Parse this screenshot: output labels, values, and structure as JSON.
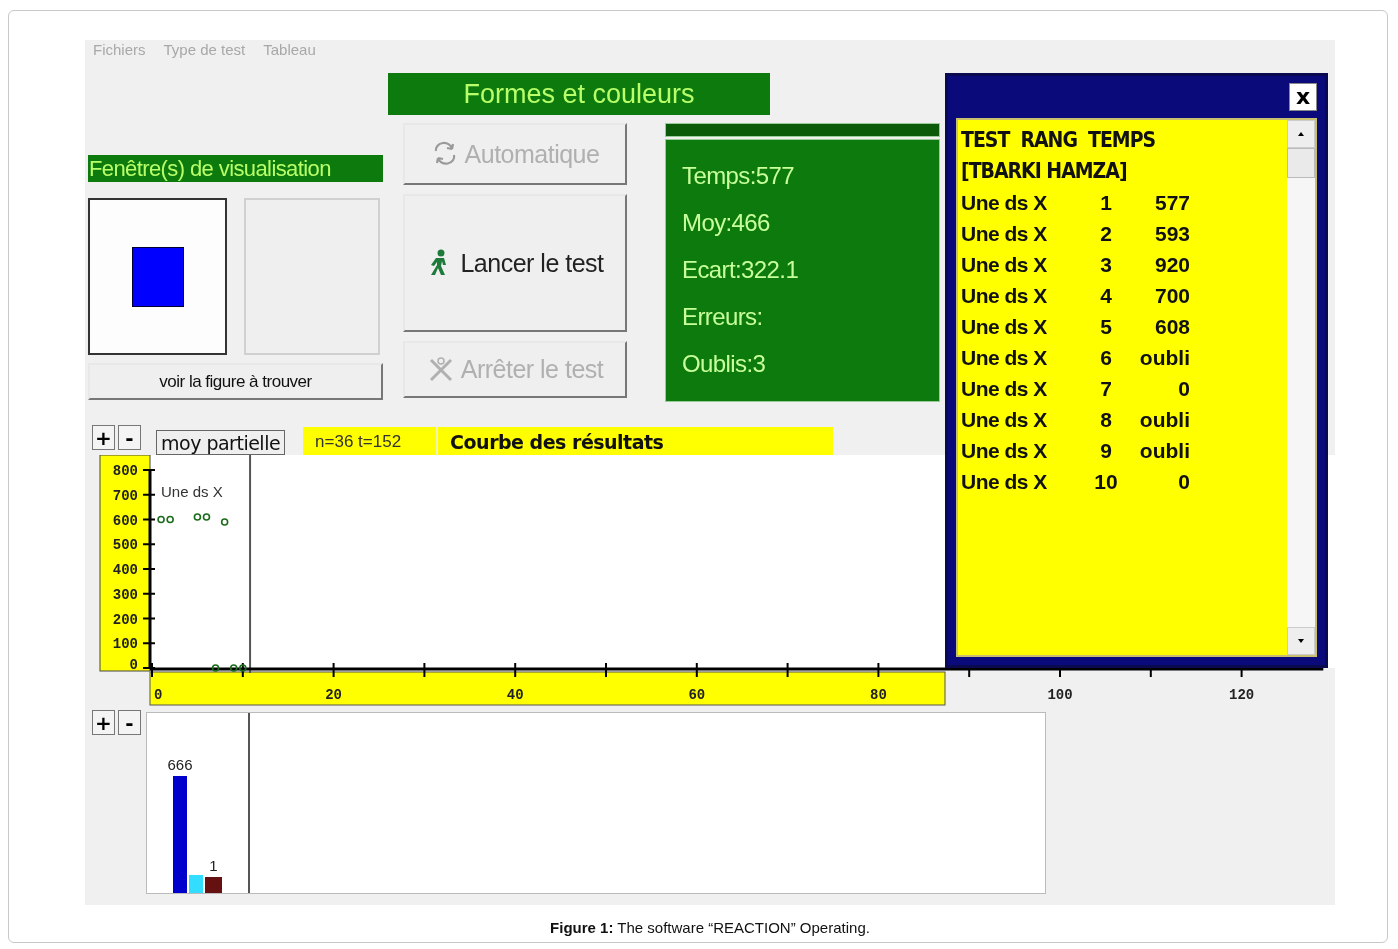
{
  "menu": [
    {
      "label": "Fichiers"
    },
    {
      "label": "Type de test"
    },
    {
      "label": "Tableau"
    }
  ],
  "test_title": "Formes et couleurs",
  "viewer": {
    "label": "Fenêtre(s) de visualisation",
    "previews": [
      {
        "kind": "square",
        "color": "#0000ff"
      },
      {
        "kind": "empty"
      }
    ],
    "button": "voir la figure à trouver"
  },
  "controls": [
    {
      "label": "Automatique",
      "disabled": true
    },
    {
      "label": "Lancer le test",
      "disabled": false
    },
    {
      "label": "Arrêter le test",
      "disabled": true
    }
  ],
  "stats": [
    "Temps:577",
    "Moy:466",
    "Ecart:322.1",
    "Erreurs:",
    "Oublis:3"
  ],
  "result_window": {
    "close": "x",
    "header": "TEST  RANG  TEMPS",
    "subject": "[TBARKI HAMZA]",
    "rows": [
      {
        "test": "Une ds X",
        "rank": "1",
        "time": "577"
      },
      {
        "test": "Une ds X",
        "rank": "2",
        "time": "593"
      },
      {
        "test": "Une ds X",
        "rank": "3",
        "time": "920"
      },
      {
        "test": "Une ds X",
        "rank": "4",
        "time": "700"
      },
      {
        "test": "Une ds X",
        "rank": "5",
        "time": "608"
      },
      {
        "test": "Une ds X",
        "rank": "6",
        "time": "oubli"
      },
      {
        "test": "Une ds X",
        "rank": "7",
        "time": "0"
      },
      {
        "test": "Une ds X",
        "rank": "8",
        "time": "oubli"
      },
      {
        "test": "Une ds X",
        "rank": "9",
        "time": "oubli"
      },
      {
        "test": "Une ds X",
        "rank": "10",
        "time": "0"
      }
    ]
  },
  "curve_panel": {
    "zoom_in": "+",
    "zoom_out": "-",
    "partial_button": "moy partielle",
    "counts": "n=36 t=152",
    "title": "Courbe des résultats",
    "chart_data": {
      "type": "scatter",
      "x": [
        1,
        2,
        5,
        6,
        8,
        7,
        9,
        10
      ],
      "series": [
        {
          "name": "Une ds X",
          "color": "#1a6b1a",
          "values": [
            600,
            600,
            610,
            610,
            590,
            0,
            0,
            0
          ]
        }
      ],
      "xlim": [
        0,
        129
      ],
      "ylim": [
        0,
        800
      ],
      "xticks": [
        0,
        20,
        40,
        60,
        80,
        100,
        120
      ],
      "yticks": [
        0,
        100,
        200,
        300,
        400,
        500,
        600,
        700,
        800
      ],
      "ref_lines": [
        {
          "axis": "x",
          "value": 10.8
        }
      ]
    }
  },
  "histogram_panel": {
    "zoom_in": "+",
    "zoom_out": "-",
    "bars": [
      {
        "label": "666",
        "color": "#0000cc"
      },
      {
        "color": "#33ddff"
      },
      {
        "label": "1",
        "color": "#661111"
      }
    ]
  },
  "caption": "**Figure 1:** The software “REACTION” Operating."
}
